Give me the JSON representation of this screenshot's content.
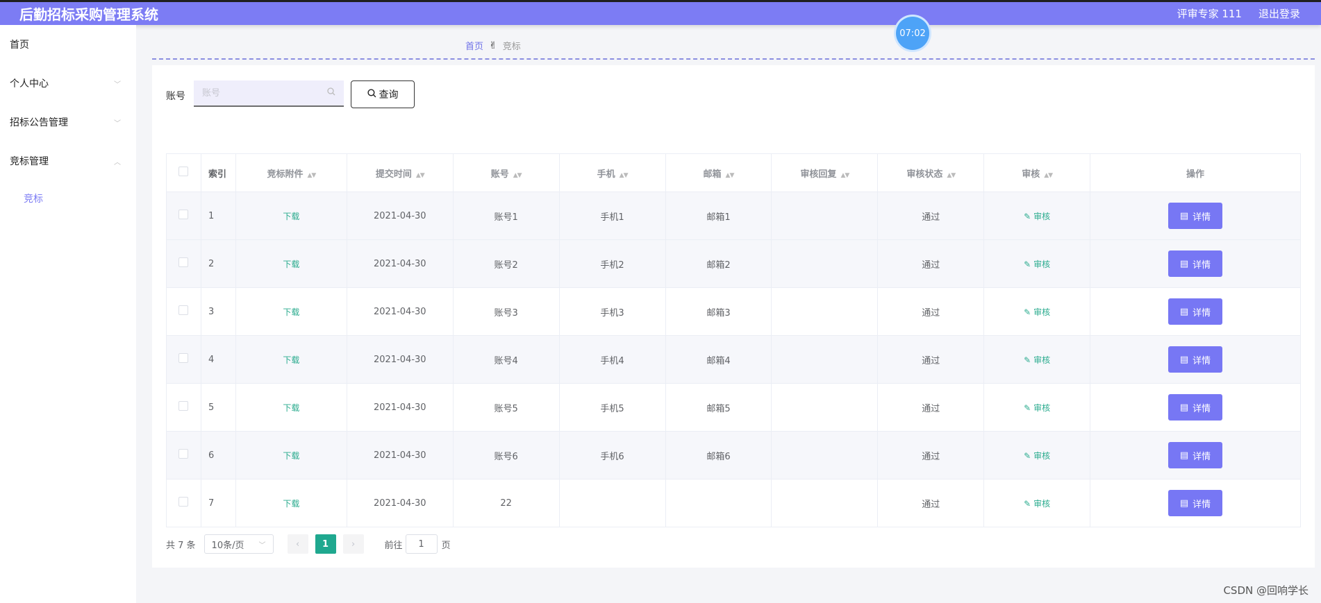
{
  "header": {
    "app_title": "后勤招标采购管理系统",
    "user": "评审专家 111",
    "logout": "退出登录"
  },
  "timer": "07:02",
  "sidebar": {
    "items": [
      {
        "label": "首页"
      },
      {
        "label": "个人中心"
      },
      {
        "label": "招标公告管理"
      },
      {
        "label": "竞标管理"
      }
    ],
    "sub_items": [
      {
        "label": "竞标"
      }
    ]
  },
  "breadcrumb": {
    "home": "首页",
    "separator": "✌",
    "current": "竞标"
  },
  "search": {
    "label": "账号",
    "placeholder": "账号",
    "button": "查询"
  },
  "table": {
    "columns": [
      "索引",
      "竞标附件",
      "提交时间",
      "账号",
      "手机",
      "邮箱",
      "审核回复",
      "审核状态",
      "审核",
      "操作"
    ],
    "rows": [
      {
        "index": "1",
        "attachment": "下载",
        "time": "2021-04-30",
        "account": "账号1",
        "phone": "手机1",
        "email": "邮箱1",
        "reply": "",
        "status": "通过",
        "audit": "审核",
        "action": "详情"
      },
      {
        "index": "2",
        "attachment": "下载",
        "time": "2021-04-30",
        "account": "账号2",
        "phone": "手机2",
        "email": "邮箱2",
        "reply": "",
        "status": "通过",
        "audit": "审核",
        "action": "详情"
      },
      {
        "index": "3",
        "attachment": "下载",
        "time": "2021-04-30",
        "account": "账号3",
        "phone": "手机3",
        "email": "邮箱3",
        "reply": "",
        "status": "通过",
        "audit": "审核",
        "action": "详情"
      },
      {
        "index": "4",
        "attachment": "下载",
        "time": "2021-04-30",
        "account": "账号4",
        "phone": "手机4",
        "email": "邮箱4",
        "reply": "",
        "status": "通过",
        "audit": "审核",
        "action": "详情"
      },
      {
        "index": "5",
        "attachment": "下载",
        "time": "2021-04-30",
        "account": "账号5",
        "phone": "手机5",
        "email": "邮箱5",
        "reply": "",
        "status": "通过",
        "audit": "审核",
        "action": "详情"
      },
      {
        "index": "6",
        "attachment": "下载",
        "time": "2021-04-30",
        "account": "账号6",
        "phone": "手机6",
        "email": "邮箱6",
        "reply": "",
        "status": "通过",
        "audit": "审核",
        "action": "详情"
      },
      {
        "index": "7",
        "attachment": "下载",
        "time": "2021-04-30",
        "account": "22",
        "phone": "",
        "email": "",
        "reply": "",
        "status": "通过",
        "audit": "审核",
        "action": "详情"
      }
    ]
  },
  "pagination": {
    "total": "共 7 条",
    "page_size": "10条/页",
    "current_page": "1",
    "goto_label": "前往",
    "goto_value": "1",
    "page_suffix": "页"
  },
  "watermark": "CSDN @回响学长",
  "colors": {
    "header_bg": "#7c7cf4",
    "accent": "#1fa88f",
    "detail_button": "#7777f4"
  }
}
